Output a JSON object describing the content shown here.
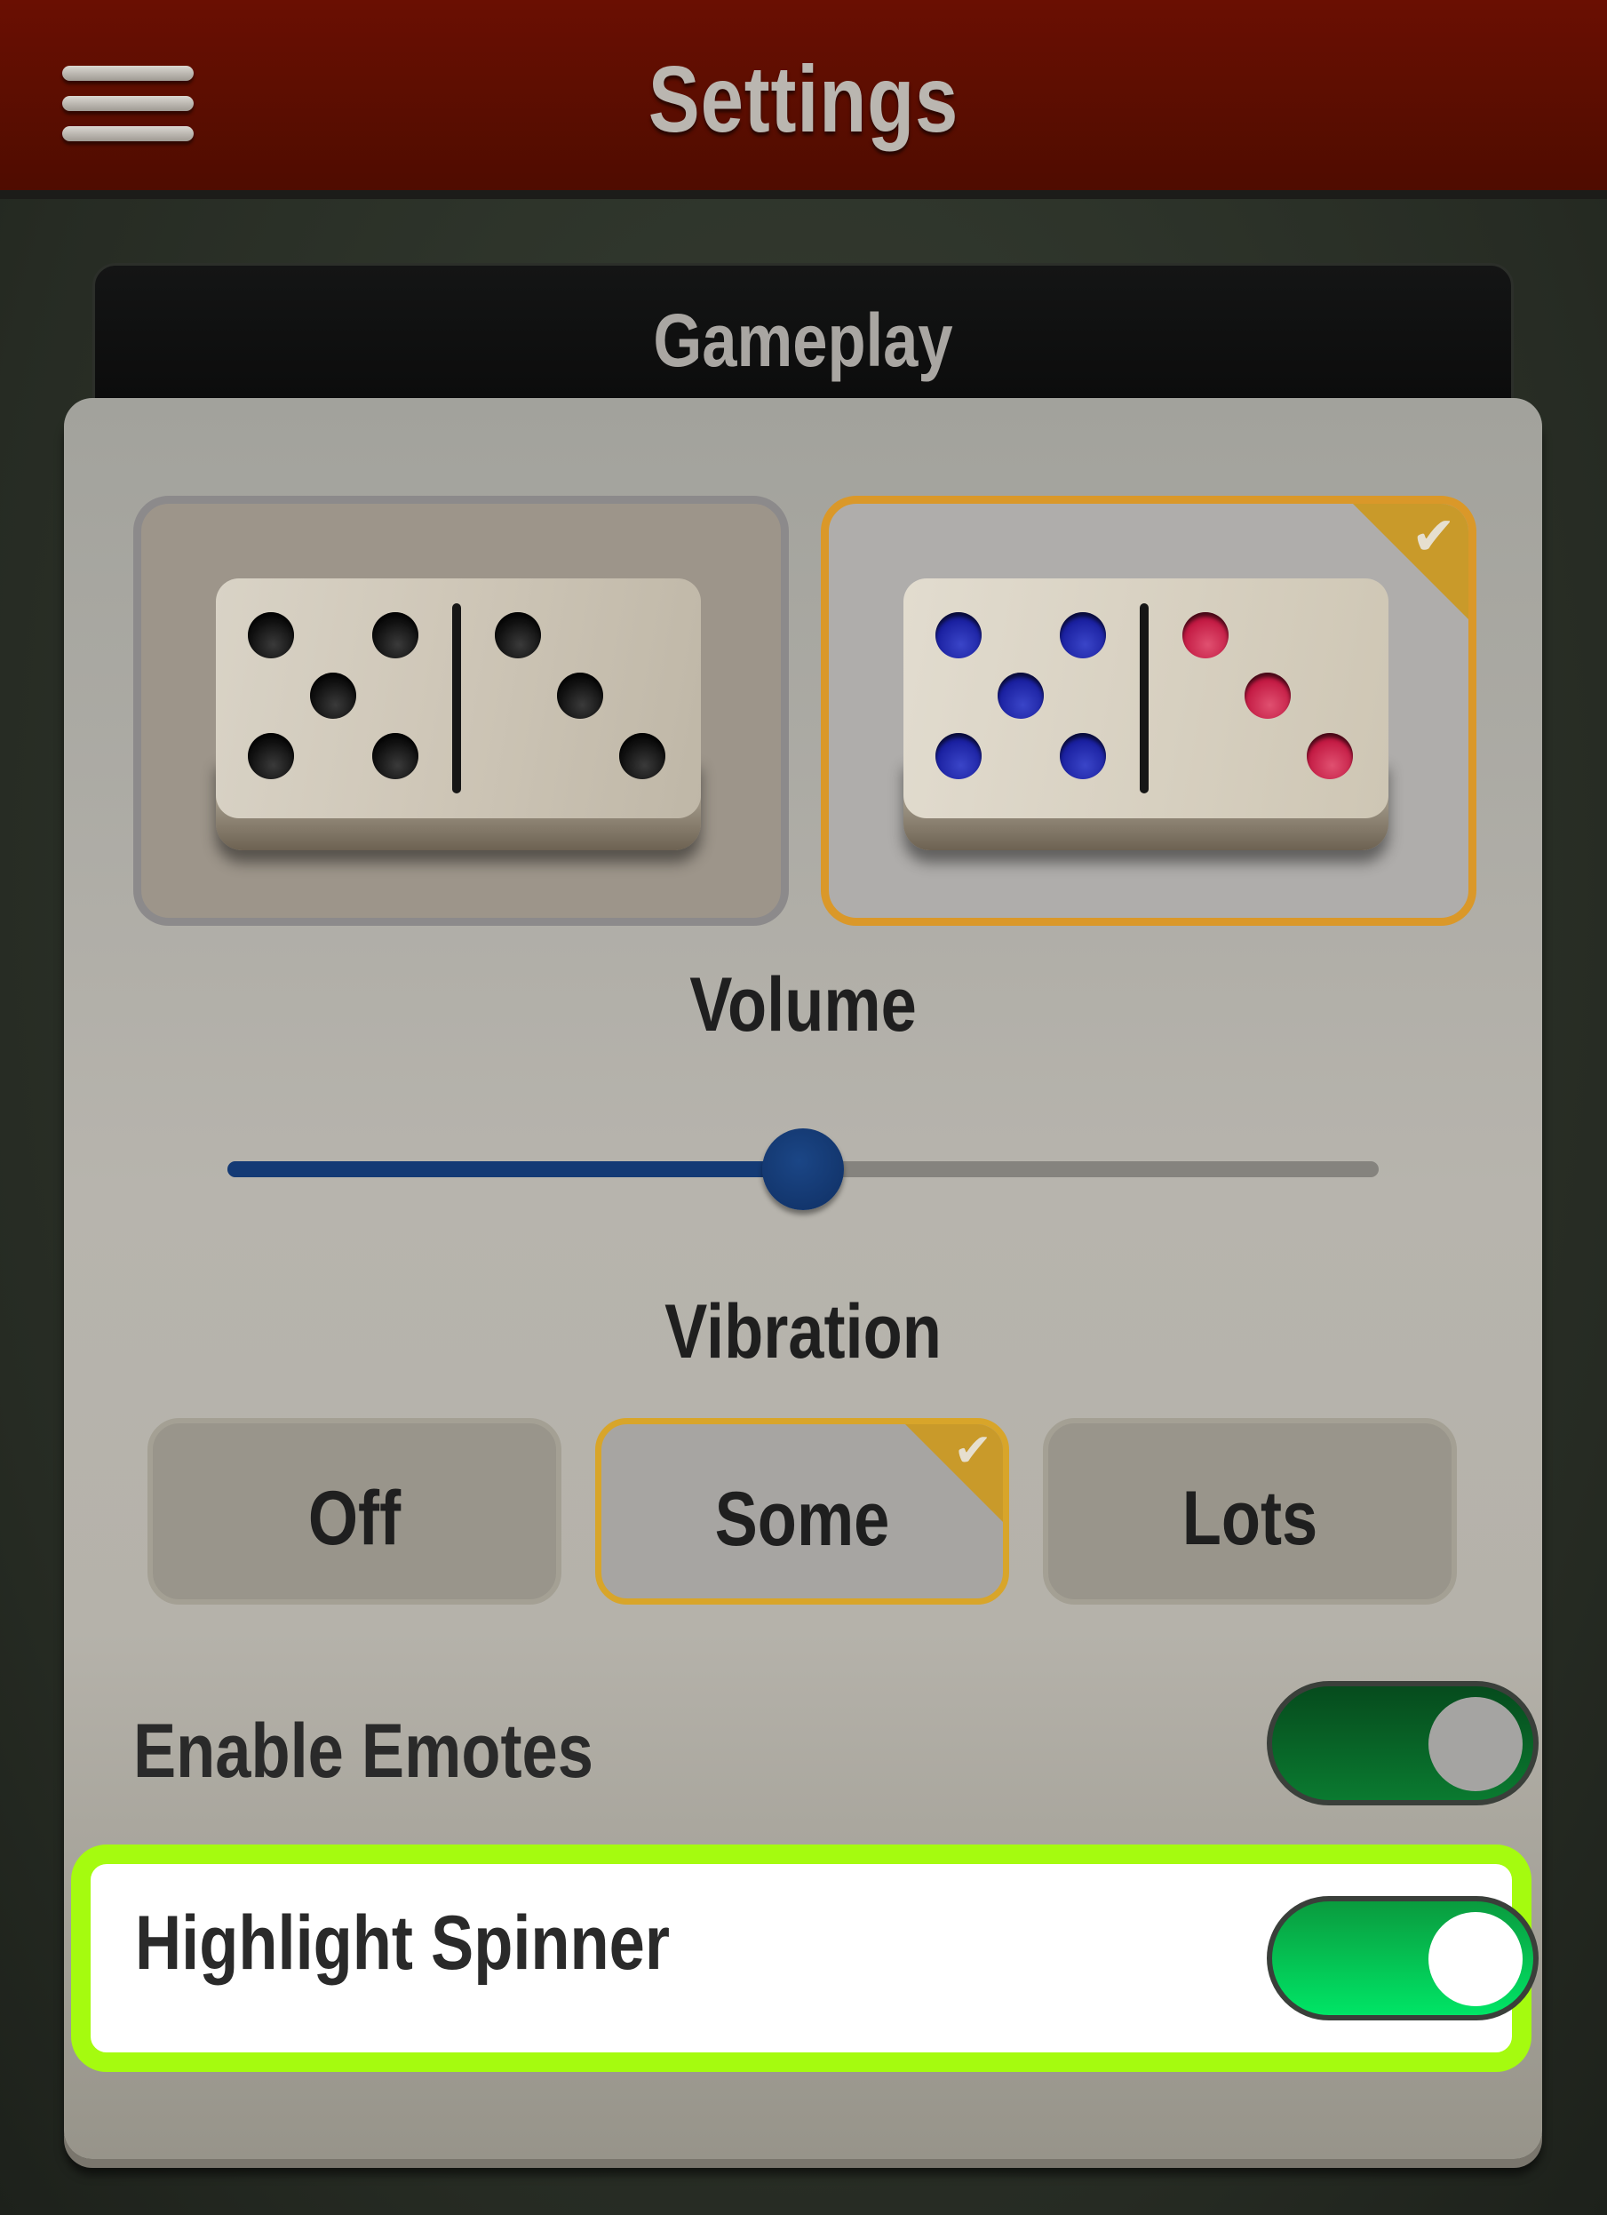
{
  "header": {
    "title": "Settings",
    "menu_icon": "hamburger-menu-icon",
    "background_color": "#5e0d00"
  },
  "section": {
    "title": "Gameplay"
  },
  "domino_styles": {
    "selected": "color",
    "options": [
      {
        "id": "classic",
        "pip_color": "black"
      },
      {
        "id": "color",
        "left_pip_color": "#1a20a0",
        "right_pip_color": "#c31a43"
      }
    ],
    "checkmark_icon": "check-icon",
    "accent_color": "#da9829"
  },
  "volume": {
    "label": "Volume",
    "level": 0.5,
    "fill_color": "#143a75"
  },
  "vibration": {
    "label": "Vibration",
    "selected": "Some",
    "options": [
      "Off",
      "Some",
      "Lots"
    ]
  },
  "toggles": {
    "enable_emotes": {
      "label": "Enable Emotes",
      "on": true
    },
    "highlight_spinner": {
      "label": "Highlight Spinner",
      "on": true,
      "highlight_color": "#a5fb0f"
    }
  }
}
